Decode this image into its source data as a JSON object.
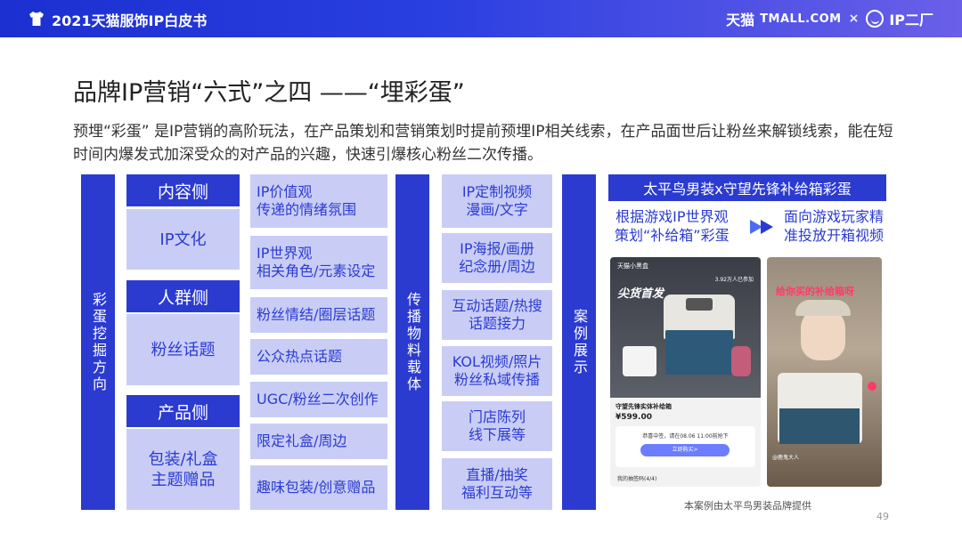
{
  "header": {
    "title": "2021天猫服饰IP白皮书",
    "brand_tmall": "天猫",
    "brand_tmall_url": "TMALL.COM",
    "times": "×",
    "brand_ip": "IP二厂"
  },
  "title": "品牌IP营销“六式”之四 ——“埋彩蛋”",
  "intro": "预埋“彩蛋” 是IP营销的高阶玩法，在产品策划和营销策划时提前预埋IP相关线索，在产品面世后让粉丝来解锁线索，能在短时间内爆发式加深受众的对产品的兴趣，快速引爆核心粉丝二次传播。",
  "left_label": "彩蛋挖掘方向",
  "categories": [
    {
      "head": "内容侧",
      "body": "IP文化"
    },
    {
      "head": "人群侧",
      "body": "粉丝话题"
    },
    {
      "head": "产品侧",
      "body": "包装/礼盒\n主题赠品"
    }
  ],
  "mid_cells": [
    "IP价值观\n传递的情绪氛围",
    "IP世界观\n相关角色/元素设定",
    "粉丝情结/圈层话题",
    "公众热点话题",
    "UGC/粉丝二次创作",
    "限定礼盒/周边",
    "趣味包装/创意赠品"
  ],
  "media_label": "传播物料载体",
  "media_cells": [
    "IP定制视频\n漫画/文字",
    "IP海报/画册\n纪念册/周边",
    "互动话题/热搜\n话题接力",
    "KOL视频/照片\n粉丝私域传播",
    "门店陈列\n线下展等",
    "直播/抽奖\n福利互动等"
  ],
  "case_label": "案例展示",
  "case": {
    "head": "太平鸟男装x守望先锋补给箱彩蛋",
    "left_text": "根据游戏IP世界观\n策划“补给箱”彩蛋",
    "right_text": "面向游戏玩家精\n准投放开箱视频",
    "phone1": {
      "badge": "尖货首发",
      "brand": "天猫小黑盒",
      "follow": "3.92万人已参加",
      "product": "守望先锋实体补给箱",
      "price": "¥599.00",
      "win": "恭喜中签，请在08.06 11:00前抢下",
      "buy": "立即购买>",
      "codes": "我的抽签码(4/4)"
    },
    "phone2": {
      "overlay": "给你买的补给箱呀",
      "user": "@鹿鬼大人"
    },
    "caption": "本案例由太平鸟男装品牌提供"
  },
  "page_number": "49",
  "colors": {
    "primary": "#2b3bd0",
    "light": "#c9cdf6"
  }
}
